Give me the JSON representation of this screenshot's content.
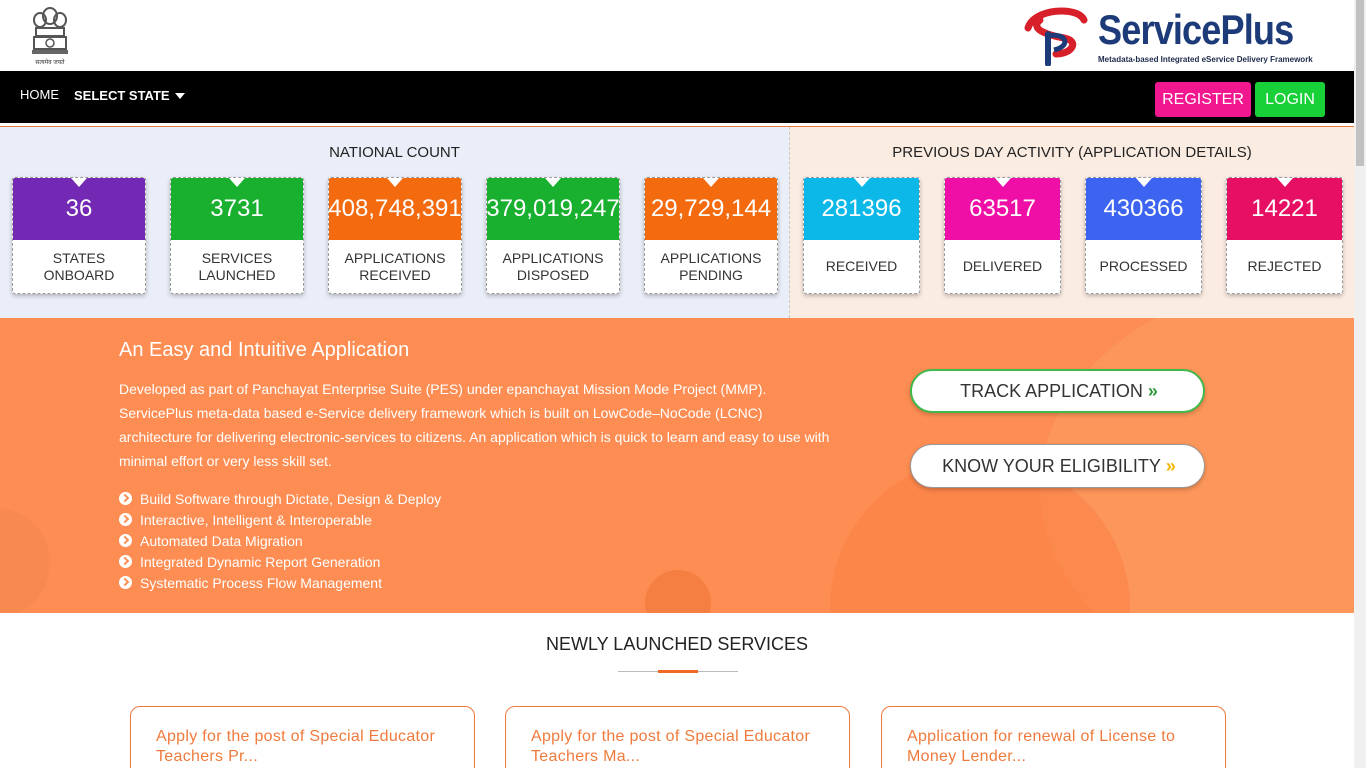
{
  "header": {
    "emblem_caption": "सत्यमेव जयते",
    "brand_name": "ServicePlus",
    "brand_tagline": "Metadata-based Integrated eService Delivery Framework"
  },
  "nav": {
    "home": "HOME",
    "select_state": "SELECT STATE",
    "register": "REGISTER",
    "login": "LOGIN"
  },
  "national": {
    "title": "NATIONAL COUNT",
    "cards": [
      {
        "value": "36",
        "label": "STATES ONBOARD",
        "color": "#7329b4"
      },
      {
        "value": "3731",
        "label": "SERVICES LAUNCHED",
        "color": "#18b02e"
      },
      {
        "value": "408,748,391",
        "label": "APPLICATIONS RECEIVED",
        "color": "#f46a0e"
      },
      {
        "value": "379,019,247",
        "label": "APPLICATIONS DISPOSED",
        "color": "#18b02e"
      },
      {
        "value": "29,729,144",
        "label": "APPLICATIONS PENDING",
        "color": "#f46a0e"
      }
    ]
  },
  "previous": {
    "title": "PREVIOUS DAY ACTIVITY (APPLICATION DETAILS)",
    "cards": [
      {
        "value": "281396",
        "label": "RECEIVED",
        "color": "#0bb8e8"
      },
      {
        "value": "63517",
        "label": "DELIVERED",
        "color": "#ef0fa6"
      },
      {
        "value": "430366",
        "label": "PROCESSED",
        "color": "#3c64f0"
      },
      {
        "value": "14221",
        "label": "REJECTED",
        "color": "#e70f63"
      }
    ]
  },
  "hero": {
    "title": "An Easy and Intuitive Application",
    "description": "Developed as part of Panchayat Enterprise Suite (PES) under epanchayat Mission Mode Project (MMP). ServicePlus meta-data based e-Service delivery framework which is built on LowCode–NoCode (LCNC) architecture for delivering electronic-services to citizens. An application which is quick to learn and easy to use with minimal effort or very less skill set.",
    "features": [
      "Build Software through Dictate, Design & Deploy",
      "Interactive, Intelligent & Interoperable",
      "Automated Data Migration",
      "Integrated Dynamic Report Generation",
      "Systematic Process Flow Management"
    ],
    "track_button": "TRACK APPLICATION",
    "eligibility_button": "KNOW YOUR ELIGIBILITY",
    "chevron": "»",
    "track_chevron_color": "#2f9a3a",
    "eligibility_chevron_color": "#f5b800"
  },
  "newly_launched": {
    "title": "NEWLY LAUNCHED SERVICES",
    "cards": [
      {
        "line1": "Apply for the post of Special Educator",
        "line2": "Teachers Pr..."
      },
      {
        "line1": "Apply for the post of Special Educator",
        "line2": "Teachers Ma..."
      },
      {
        "line1": "Application for renewal of License to",
        "line2": "Money Lender..."
      }
    ]
  }
}
